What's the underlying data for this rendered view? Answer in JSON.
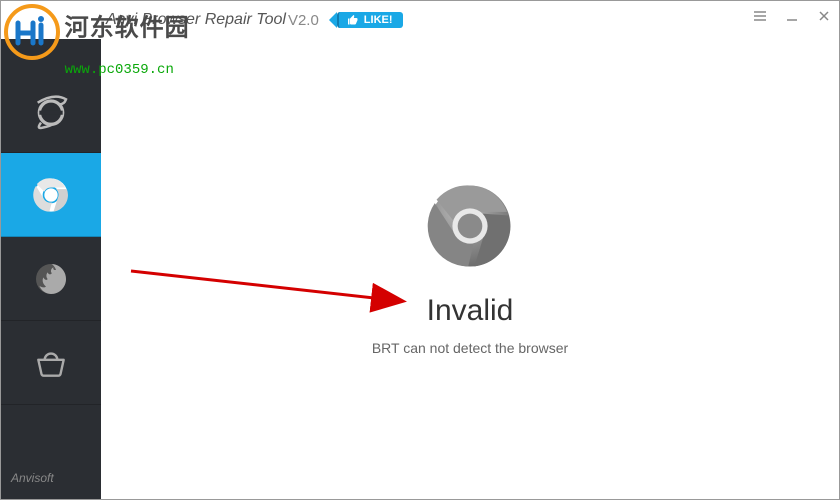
{
  "title": {
    "app": "Anvi Browser Repair Tool",
    "version": "V2.0",
    "like_label": "LIKE!"
  },
  "sidebar": {
    "items": [
      {
        "name": "ie",
        "active": false
      },
      {
        "name": "chrome",
        "active": true
      },
      {
        "name": "firefox",
        "active": false
      },
      {
        "name": "store",
        "active": false
      }
    ],
    "footer": "Anvisoft"
  },
  "main": {
    "status_title": "Invalid",
    "status_message": "BRT can not detect the browser"
  },
  "watermark": {
    "cn": "河东软件园",
    "url": "www.pc0359.cn"
  },
  "colors": {
    "accent": "#1aa8e6",
    "sidebar_bg": "#2b2e33"
  }
}
